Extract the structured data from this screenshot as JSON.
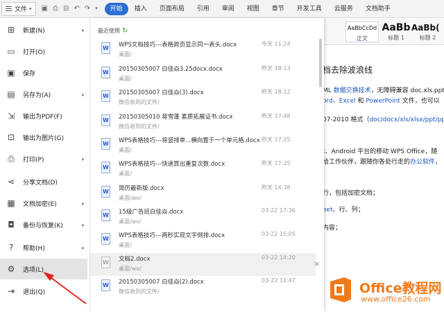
{
  "topbar": {
    "file_label": "文件",
    "tabs": [
      "开始",
      "插入",
      "页面布局",
      "引用",
      "审阅",
      "视图",
      "章节",
      "开发工具",
      "云服务",
      "文档助手"
    ],
    "active_tab": "开始"
  },
  "styles": [
    {
      "preview": "AaBbCcDd",
      "name": "正文"
    },
    {
      "preview": "AaBb",
      "name": "标题 1"
    },
    {
      "preview": "AaBb(",
      "name": "标题 2"
    }
  ],
  "menu": {
    "items": [
      {
        "label": "新建(N)",
        "icon": "new-file-icon",
        "arrow": true
      },
      {
        "label": "打开(O)",
        "icon": "folder-open-icon",
        "arrow": false
      },
      {
        "label": "保存",
        "icon": "save-icon",
        "arrow": false
      },
      {
        "label": "另存为(A)",
        "icon": "save-as-icon",
        "arrow": true
      },
      {
        "label": "输出为PDF(F)",
        "icon": "export-pdf-icon",
        "arrow": false
      },
      {
        "label": "输出为图片(G)",
        "icon": "export-image-icon",
        "arrow": false
      },
      {
        "label": "打印(P)",
        "icon": "print-icon",
        "arrow": true
      },
      {
        "label": "分享文档(D)",
        "icon": "share-icon",
        "arrow": false
      },
      {
        "label": "文档加密(E)",
        "icon": "encrypt-icon",
        "arrow": true
      },
      {
        "label": "备份与恢复(K)",
        "icon": "backup-icon",
        "arrow": true
      },
      {
        "label": "帮助(H)",
        "icon": "help-icon",
        "arrow": true
      },
      {
        "label": "选项(L)",
        "icon": "gear-icon",
        "arrow": false
      },
      {
        "label": "退出(Q)",
        "icon": "exit-icon",
        "arrow": false
      }
    ]
  },
  "recent": {
    "title": "最近使用",
    "files": [
      {
        "name": "WPS文档技巧---表格跨页显示同一表头.docx",
        "path": "桌面/",
        "time": "今天 11:24"
      },
      {
        "name": "20150305007 白佳焱3.25docx.docx",
        "path": "桌面/",
        "time": "昨天 18:13"
      },
      {
        "name": "20150305007 白佳焱(3).docx",
        "path": "微信收到的文件/",
        "time": "昨天 18:12"
      },
      {
        "name": "20150305010 蒋雪蓬 素质拓展证书.docx",
        "path": "微信收到的文件/",
        "time": "昨天 17:48"
      },
      {
        "name": "WPS表格技巧---将竖排单...横向置于一个单元格.docx",
        "path": "桌面/",
        "time": "昨天 17:25"
      },
      {
        "name": "WPS表格技巧---快速算出重复次数.docx",
        "path": "桌面/",
        "time": "昨天 17:25"
      },
      {
        "name": "简历最新版.docx",
        "path": "桌面/wo/",
        "time": "昨天 14:38"
      },
      {
        "name": "15级广告班白佳焱.docx",
        "path": "桌面/wo/",
        "time": "03-22 17:36"
      },
      {
        "name": "WPS表格技巧---两秒实现文字倒排.docx",
        "path": "桌面/",
        "time": "03-22 15:05"
      },
      {
        "name": "文档2.docx",
        "path": "桌面/wo/",
        "time": "03-22 14:20"
      },
      {
        "name": "20150305007 白佳焱(2).docx",
        "path": "微信收到的文件/",
        "time": "03-22 11:47"
      }
    ]
  },
  "document": {
    "heading": "档去除波浪线",
    "line1a": "ML ",
    "line1b": "数据交换技术",
    "line1c": "，无障碍兼容 doc.xls.ppt",
    "line2a": "ord",
    "line2b": "、",
    "line2c": "Excel",
    "line2d": " 和 ",
    "line2e": "PowerPoint",
    "line2f": " 文件，也可以",
    "line3a": "07-2010 格式（",
    "line3b": "doc/docx/xls/xlsx/ppt/pptx",
    "line4": "t、Android 平台的移动 WPS Office，随",
    "line5a": "给工作伙伴，跟随你各处行走的",
    "line5b": "办公软件",
    "line5c": "，",
    "line6": "行，包括加密文档；",
    "line7a": "eet",
    "line7b": "、行、列；",
    "line8": "内容；"
  },
  "watermark": {
    "title": "Office教程网",
    "url": "www.office26.com"
  },
  "colors": {
    "accent": "#2b6fd6",
    "watermark": "#f07a1a",
    "link": "#1a56c7"
  }
}
